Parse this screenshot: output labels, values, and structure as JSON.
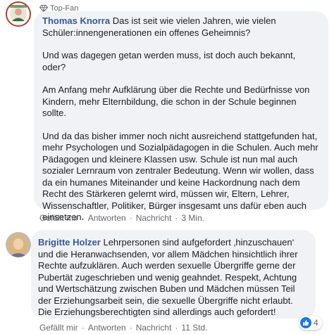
{
  "comments": [
    {
      "badge": "Top-Fan",
      "author": "Thomas Knorra",
      "paragraphs": [
        "Das ist seit wie vielen Jahren, wie vielen Schüler:innengenerationen ein offenes Geheimnis?",
        "Und was dagegen getan werden muss, ist doch auch bekannt, oder?",
        "Am Anfang mehr Aufklärung über die Rechte und Bedürfnisse von Kindern, mehr Elternbildung, die schon in der Schule beginnen sollte.",
        "Und da das bisher immer noch nicht ausreichend stattgefunden hat, mehr Psychologen und Sozialpädagogen in die Schulen. Auch mehr Pädagogen und kleinere Klassen usw. Schule ist nun mal auch sozialer Lernraum von zentraler Bedeutung. Wenn wir wollen, dass da ein humanes Miteinander und keine Hackordnung nach dem Recht des Stärkeren gelernt wird, müssen wir, Eltern, Lehrer, Wissenschaftler, Politiker, Bürger insgesamt uns dafür eben auch einsetzen."
      ],
      "actions": {
        "like": "Gefällt mir",
        "reply": "Antworten",
        "message": "Nachricht",
        "time": "3 Min."
      }
    },
    {
      "author": "Brigitte Holzer",
      "paragraphs": [
        "Lehrpersonen sind aufgefordert ‚hinzuschauen‘ und die Heranwachsenden, vor allem Mädchen hinsichtlich ihrer Rechte aufzuklären. Auch werden sexuelle Übergriffe gerne der Pubertät zugeschrieben und wenig geahndet. Respekt, Achtung und Wertschätzung zwischen Buben und Mädchen müssen Teil der Erziehungsarbeit sein, die sexuelle Übergriffe nicht erlaubt. Die Erziehungsberechtigten sind allerdings auch gefordert!"
      ],
      "actions": {
        "like": "Gefällt mir",
        "reply": "Antworten",
        "message": "Nachricht",
        "time": "11 Std."
      },
      "reaction_count": "4"
    }
  ],
  "colors": {
    "author": "#385898",
    "bubble": "#f0f2f5",
    "like": "#1877f2"
  }
}
